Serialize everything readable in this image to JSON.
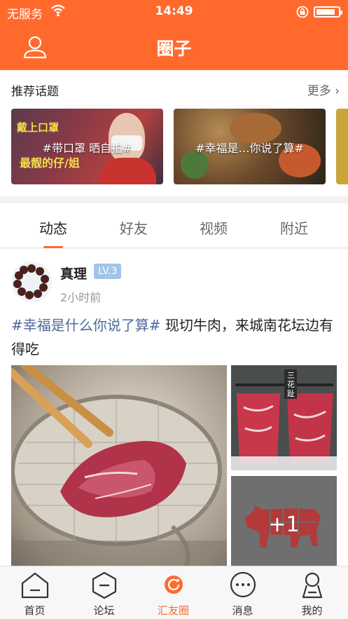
{
  "status_bar": {
    "carrier": "无服务",
    "time": "14:49",
    "battery_level": 0.85
  },
  "header": {
    "title": "圈子",
    "profile_icon": "user-icon"
  },
  "topics": {
    "section_title": "推荐话题",
    "more_label": "更多",
    "cards": [
      {
        "tag": "#带口罩 晒自拍#",
        "art_line1": "戴上口罩",
        "art_line2": "最靓的仔/姐"
      },
      {
        "tag": "#幸福是…你说了算#"
      }
    ]
  },
  "tabs": [
    {
      "label": "动态",
      "active": true
    },
    {
      "label": "好友",
      "active": false
    },
    {
      "label": "视频",
      "active": false
    },
    {
      "label": "附近",
      "active": false
    }
  ],
  "post": {
    "username": "真理",
    "level": "LV.3",
    "time": "2小时前",
    "hashtag": "#幸福是什么你说了算#",
    "text": " 现切牛肉，来城南花坛边有得吃",
    "side_label": "三花趾",
    "more_images": "+1"
  },
  "bottom_nav": [
    {
      "label": "首页",
      "icon": "home-icon",
      "active": false
    },
    {
      "label": "论坛",
      "icon": "forum-icon",
      "active": false
    },
    {
      "label": "汇友圈",
      "icon": "circle-icon",
      "active": true
    },
    {
      "label": "消息",
      "icon": "message-icon",
      "active": false
    },
    {
      "label": "我的",
      "icon": "profile-icon",
      "active": false
    }
  ],
  "colors": {
    "accent": "#ff6a2c",
    "hashtag": "#4b6a9b",
    "level_badge": "#a2c4e6"
  }
}
